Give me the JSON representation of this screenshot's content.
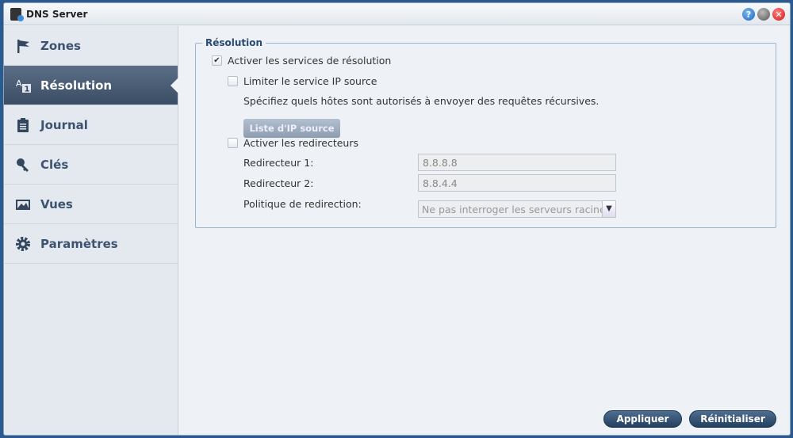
{
  "window": {
    "title": "DNS Server",
    "buttons": [
      {
        "name": "help",
        "glyph": "?"
      },
      {
        "name": "minimize",
        "glyph": ""
      },
      {
        "name": "close",
        "glyph": "✕"
      }
    ]
  },
  "sidebar": {
    "active": "Résolution",
    "items": [
      {
        "label": "Zones",
        "icon": "flag-icon"
      },
      {
        "label": "Résolution",
        "icon": "resolution-icon"
      },
      {
        "label": "Journal",
        "icon": "clipboard-icon"
      },
      {
        "label": "Clés",
        "icon": "key-icon"
      },
      {
        "label": "Vues",
        "icon": "views-icon"
      },
      {
        "label": "Paramètres",
        "icon": "gear-icon"
      }
    ]
  },
  "resolution": {
    "legend": "Résolution",
    "enable_label": "Activer les services de résolution",
    "enable_checked": true,
    "limit_label": "Limiter le service IP source",
    "limit_checked": false,
    "hint": "Spécifiez quels hôtes sont autorisés à envoyer des requêtes récursives.",
    "source_list_button": "Liste d'IP source",
    "forwarders_label": "Activer les redirecteurs",
    "forwarders_checked": false,
    "forwarder1_label": "Redirecteur 1:",
    "forwarder1_value": "8.8.8.8",
    "forwarder2_label": "Redirecteur 2:",
    "forwarder2_value": "8.8.4.4",
    "policy_label": "Politique de redirection:",
    "policy_value": "Ne pas interroger les serveurs racines"
  },
  "footer": {
    "apply": "Appliquer",
    "reset": "Réinitialiser"
  },
  "colors": {
    "accent": "#3b4d64",
    "button": "#23405f"
  }
}
